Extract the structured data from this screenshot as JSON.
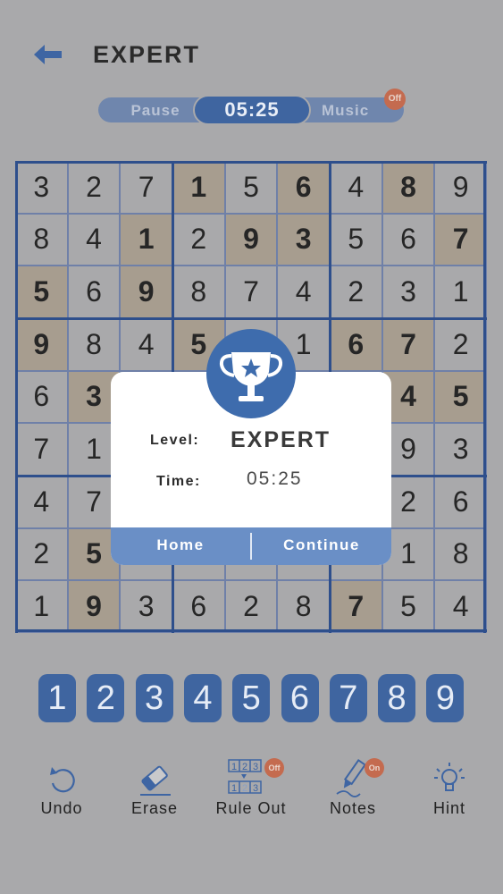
{
  "header": {
    "title": "EXPERT"
  },
  "controls": {
    "pause_label": "Pause",
    "timer": "05:25",
    "music_label": "Music",
    "music_badge": "Off"
  },
  "board": {
    "cells": [
      [
        "3",
        "2",
        "7",
        "1",
        "5",
        "6",
        "4",
        "8",
        "9"
      ],
      [
        "8",
        "4",
        "1",
        "2",
        "9",
        "3",
        "5",
        "6",
        "7"
      ],
      [
        "5",
        "6",
        "9",
        "8",
        "7",
        "4",
        "2",
        "3",
        "1"
      ],
      [
        "9",
        "8",
        "4",
        "5",
        "",
        "1",
        "6",
        "7",
        "2"
      ],
      [
        "6",
        "3",
        "",
        "",
        "",
        "",
        "",
        "4",
        "5"
      ],
      [
        "7",
        "1",
        "",
        "",
        "",
        "",
        "",
        "9",
        "3"
      ],
      [
        "4",
        "7",
        "",
        "",
        "",
        "",
        "",
        "2",
        "6"
      ],
      [
        "2",
        "5",
        "",
        "",
        "",
        "",
        "",
        "1",
        "8"
      ],
      [
        "1",
        "9",
        "3",
        "6",
        "2",
        "8",
        "7",
        "5",
        "4"
      ]
    ],
    "highlighted": [
      [
        0,
        3
      ],
      [
        0,
        5
      ],
      [
        0,
        7
      ],
      [
        1,
        2
      ],
      [
        1,
        4
      ],
      [
        1,
        5
      ],
      [
        1,
        8
      ],
      [
        2,
        0
      ],
      [
        2,
        2
      ],
      [
        3,
        0
      ],
      [
        3,
        3
      ],
      [
        3,
        6
      ],
      [
        3,
        7
      ],
      [
        4,
        1
      ],
      [
        4,
        7
      ],
      [
        4,
        8
      ],
      [
        7,
        1
      ],
      [
        8,
        1
      ],
      [
        8,
        6
      ]
    ]
  },
  "dialog": {
    "level_label": "Level:",
    "level_value": "EXPERT",
    "time_label": "Time:",
    "time_value": "05:25",
    "home_button": "Home",
    "continue_button": "Continue"
  },
  "numpad": [
    "1",
    "2",
    "3",
    "4",
    "5",
    "6",
    "7",
    "8",
    "9"
  ],
  "toolbar": {
    "undo": "Undo",
    "erase": "Erase",
    "rule_out": "Rule Out",
    "rule_out_badge": "Off",
    "notes": "Notes",
    "notes_badge": "On",
    "hint": "Hint"
  },
  "icons": [
    "back-arrow-icon",
    "trophy-icon",
    "undo-icon",
    "eraser-icon",
    "rule-out-icon",
    "pencil-icon",
    "lightbulb-icon"
  ]
}
